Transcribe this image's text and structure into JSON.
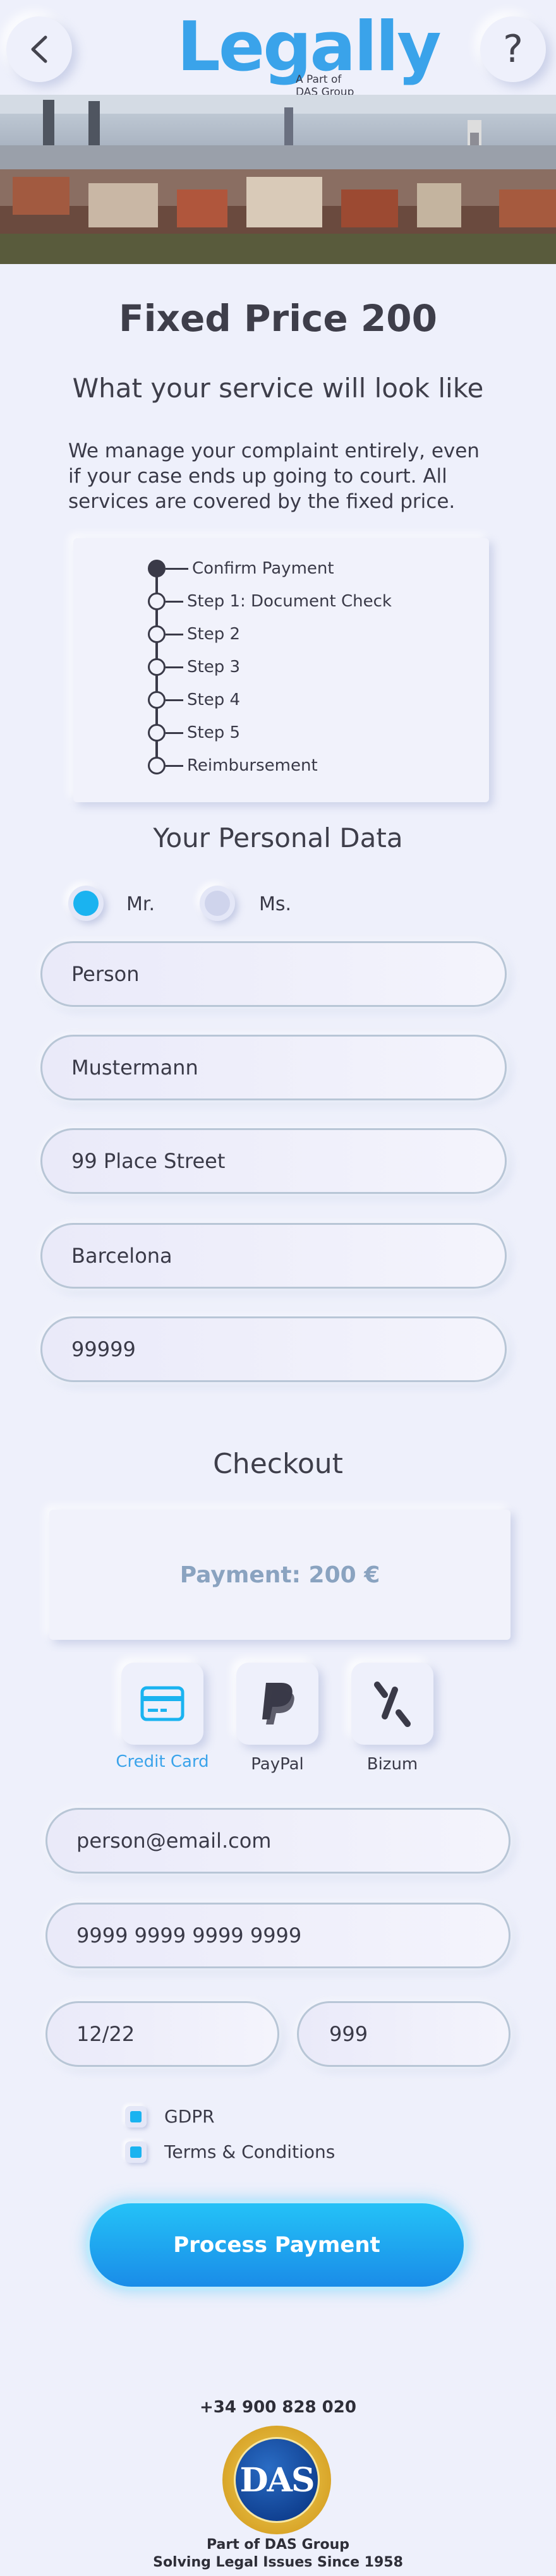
{
  "header": {
    "back_icon": "chevron-left-icon",
    "back_glyph": "<",
    "help_glyph": "?",
    "logo_word": "Legally",
    "logo_sub_line1": "A Part of",
    "logo_sub_line2": "DAS Group"
  },
  "intro": {
    "title": "Fixed Price 200",
    "subtitle": "What your service will look like",
    "description": "We manage your complaint entirely, even if your case ends up going to court. All services are covered by the fixed price."
  },
  "steps": [
    "Confirm Payment",
    "Step 1: Document Check",
    "Step 2",
    "Step 3",
    "Step 4",
    "Step 5",
    "Reimbursement"
  ],
  "personal": {
    "heading": "Your Personal Data",
    "salutation_mr": "Mr.",
    "salutation_ms": "Ms.",
    "selected": "Mr.",
    "first_name": "Person",
    "last_name": "Mustermann",
    "street": "99 Place Street",
    "city": "Barcelona",
    "zip": "99999"
  },
  "checkout": {
    "heading": "Checkout",
    "payment_label": "Payment: 200 €",
    "methods": [
      {
        "label": "Credit Card",
        "icon": "credit-card-icon",
        "selected": true
      },
      {
        "label": "PayPal",
        "icon": "paypal-icon",
        "selected": false
      },
      {
        "label": "Bizum",
        "icon": "bizum-icon",
        "selected": false
      }
    ],
    "email": "person@email.com",
    "card_number": "9999 9999 9999 9999",
    "expiry": "12/22",
    "cvv": "999",
    "gdpr_label": "GDPR",
    "terms_label": "Terms & Conditions",
    "process_label": "Process Payment"
  },
  "footer": {
    "phone": "+34 900 828 020",
    "seal_text": "DAS",
    "line1": "Part of DAS Group",
    "line2": "Solving Legal Issues Since 1958"
  },
  "colors": {
    "background": "#eef0fb",
    "accent": "#1ab3f0",
    "logo": "#3aa3ea",
    "text": "#3a3a48"
  }
}
